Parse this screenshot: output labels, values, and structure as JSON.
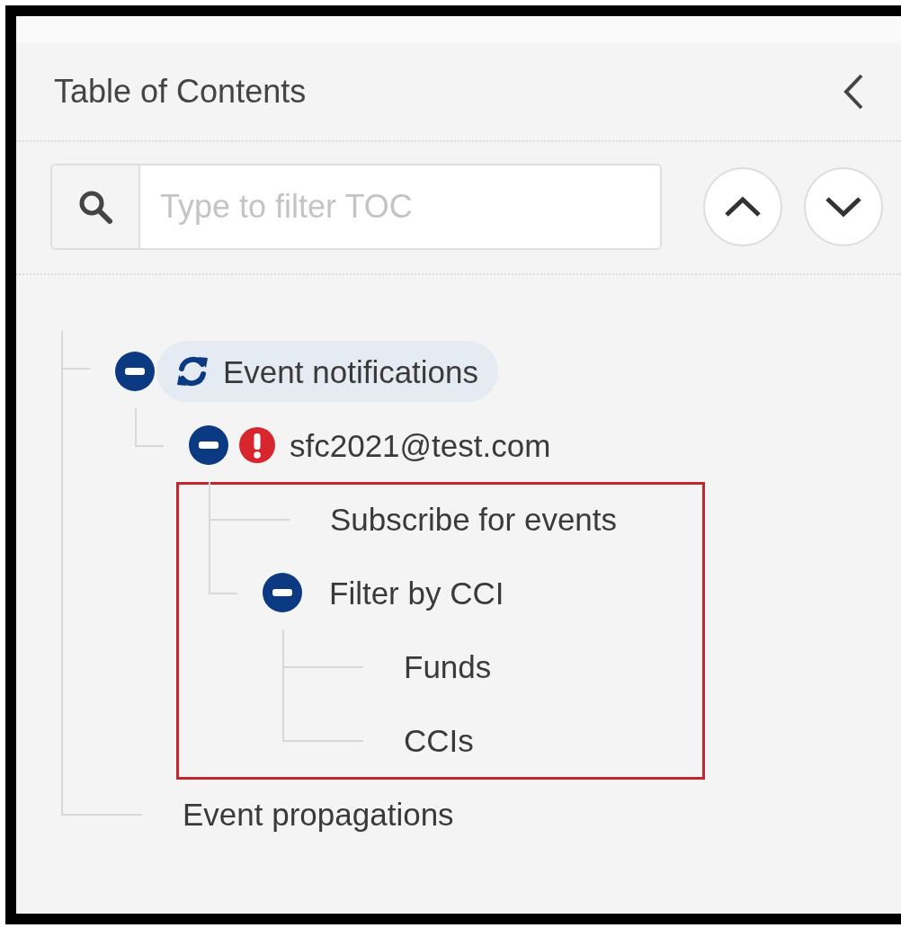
{
  "panel": {
    "title": "Table of Contents",
    "search": {
      "placeholder": "Type to filter TOC"
    }
  },
  "toc": [
    {
      "label": "Event notifications",
      "kind": "sync",
      "expanded": true,
      "selected": true,
      "children": [
        {
          "label": "sfc2021@test.com",
          "kind": "error",
          "expanded": true,
          "selected": false,
          "outlined": true,
          "children": [
            {
              "label": "Subscribe for events",
              "selected": false
            },
            {
              "label": "Filter by CCI",
              "expanded": true,
              "selected": false,
              "children": [
                {
                  "label": "Funds",
                  "selected": false
                },
                {
                  "label": "CCIs",
                  "selected": false
                }
              ]
            }
          ]
        }
      ]
    },
    {
      "label": "Event propagations",
      "selected": false
    }
  ]
}
